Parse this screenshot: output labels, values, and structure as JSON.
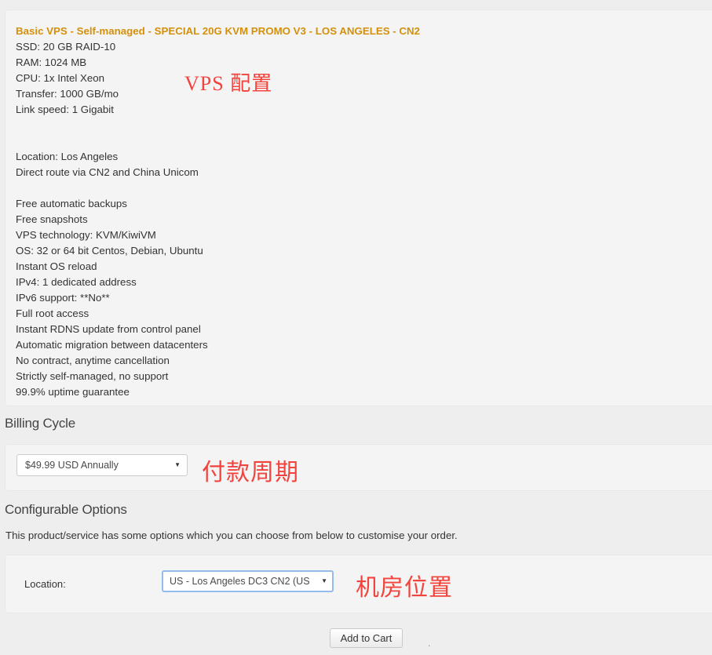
{
  "product": {
    "title": "Basic VPS - Self-managed - SPECIAL 20G KVM PROMO V3 - LOS ANGELES - CN2",
    "specs_group_1": [
      "SSD: 20 GB RAID-10",
      "RAM: 1024 MB",
      "CPU: 1x Intel Xeon",
      "Transfer: 1000 GB/mo",
      "Link speed: 1 Gigabit"
    ],
    "specs_group_2": [
      "Location: Los Angeles",
      "Direct route via CN2 and China Unicom"
    ],
    "specs_group_3": [
      "Free automatic backups",
      "Free snapshots",
      "VPS technology: KVM/KiwiVM",
      "OS: 32 or 64 bit Centos, Debian, Ubuntu",
      "Instant OS reload",
      "IPv4: 1 dedicated address",
      "IPv6 support: **No**",
      "Full root access",
      "Instant RDNS update from control panel",
      "Automatic migration between datacenters",
      "No contract, anytime cancellation",
      "Strictly self-managed, no support",
      "99.9% uptime guarantee"
    ]
  },
  "billing": {
    "heading": "Billing Cycle",
    "selected_cycle": "$49.99 USD Annually",
    "caret_icon": "▼"
  },
  "options": {
    "heading": "Configurable Options",
    "description": "This product/service has some options which you can choose from below to customise your order.",
    "location_label": "Location:",
    "location_value": "US - Los Angeles DC3 CN2 (US",
    "caret_icon": "▼"
  },
  "actions": {
    "add_to_cart_label": "Add to Cart",
    "trailing_dot": "."
  },
  "annotations": {
    "vps_config": "VPS 配置",
    "billing_cycle": "付款周期",
    "location": "机房位置",
    "color": "#f2443d"
  },
  "colors": {
    "page_background": "#eeeeee",
    "panel_background": "#f4f4f4",
    "panel_border": "#e7e7e7",
    "title_accent": "#d4900a",
    "focus_ring": "#94bbe9",
    "body_text": "#333333"
  }
}
